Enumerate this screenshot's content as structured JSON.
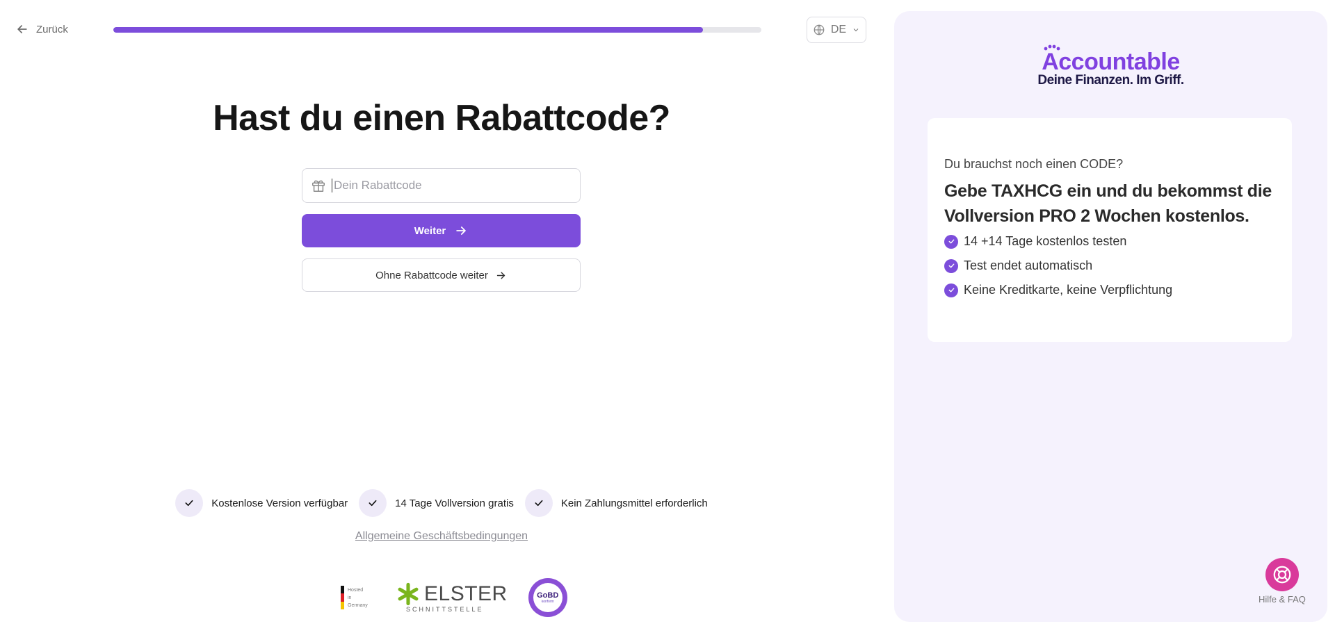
{
  "nav": {
    "back_label": "Zurück"
  },
  "progress": {
    "value_percent": 91
  },
  "language": {
    "code": "DE"
  },
  "main": {
    "title": "Hast du einen Rabattcode?",
    "code_placeholder": "Dein Rabattcode",
    "primary_label": "Weiter",
    "secondary_label": "Ohne Rabattcode weiter"
  },
  "features": [
    {
      "label": "Kostenlose Version verfügbar"
    },
    {
      "label": "14 Tage Vollversion gratis"
    },
    {
      "label": "Kein Zahlungsmittel erforderlich"
    }
  ],
  "footer": {
    "terms_link": "Allgemeine Geschäftsbedingungen",
    "hosted_lines": [
      "Hosted",
      "in",
      "Germany"
    ],
    "elster_name": "ELSTER",
    "elster_sub": "SCHNITTSTELLE",
    "gobd_main": "GoBD",
    "gobd_sub": "konform"
  },
  "brand": {
    "name": "Accountable",
    "tagline": "Deine Finanzen. Im Griff."
  },
  "promo": {
    "question": "Du brauchst noch einen CODE?",
    "headline": "Gebe TAXHCG ein und du bekommst die Vollversion PRO 2 Wochen kostenlos.",
    "items": [
      {
        "label": "14 +14 Tage kostenlos testen"
      },
      {
        "label": "Test endet automatisch"
      },
      {
        "label": "Keine Kreditkarte, keine Verpflichtung"
      }
    ]
  },
  "help": {
    "label": "Hilfe & FAQ"
  },
  "colors": {
    "accent": "#7c4ddb",
    "brand": "#8041e0",
    "panel_bg": "#f5f2fd",
    "help": "#d93a9b"
  }
}
